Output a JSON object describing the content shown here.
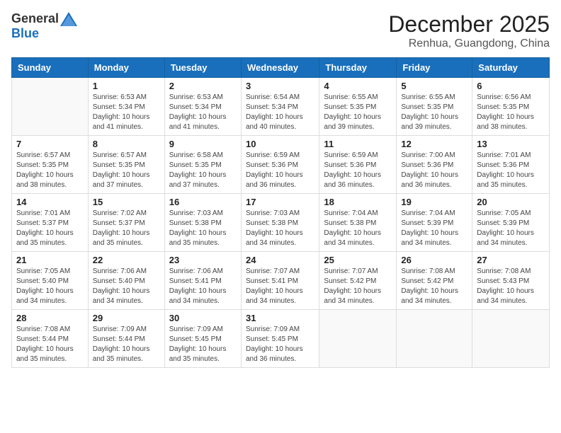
{
  "logo": {
    "general": "General",
    "blue": "Blue"
  },
  "title": "December 2025",
  "location": "Renhua, Guangdong, China",
  "headers": [
    "Sunday",
    "Monday",
    "Tuesday",
    "Wednesday",
    "Thursday",
    "Friday",
    "Saturday"
  ],
  "weeks": [
    [
      {
        "day": "",
        "info": ""
      },
      {
        "day": "1",
        "info": "Sunrise: 6:53 AM\nSunset: 5:34 PM\nDaylight: 10 hours\nand 41 minutes."
      },
      {
        "day": "2",
        "info": "Sunrise: 6:53 AM\nSunset: 5:34 PM\nDaylight: 10 hours\nand 41 minutes."
      },
      {
        "day": "3",
        "info": "Sunrise: 6:54 AM\nSunset: 5:34 PM\nDaylight: 10 hours\nand 40 minutes."
      },
      {
        "day": "4",
        "info": "Sunrise: 6:55 AM\nSunset: 5:35 PM\nDaylight: 10 hours\nand 39 minutes."
      },
      {
        "day": "5",
        "info": "Sunrise: 6:55 AM\nSunset: 5:35 PM\nDaylight: 10 hours\nand 39 minutes."
      },
      {
        "day": "6",
        "info": "Sunrise: 6:56 AM\nSunset: 5:35 PM\nDaylight: 10 hours\nand 38 minutes."
      }
    ],
    [
      {
        "day": "7",
        "info": "Sunrise: 6:57 AM\nSunset: 5:35 PM\nDaylight: 10 hours\nand 38 minutes."
      },
      {
        "day": "8",
        "info": "Sunrise: 6:57 AM\nSunset: 5:35 PM\nDaylight: 10 hours\nand 37 minutes."
      },
      {
        "day": "9",
        "info": "Sunrise: 6:58 AM\nSunset: 5:35 PM\nDaylight: 10 hours\nand 37 minutes."
      },
      {
        "day": "10",
        "info": "Sunrise: 6:59 AM\nSunset: 5:36 PM\nDaylight: 10 hours\nand 36 minutes."
      },
      {
        "day": "11",
        "info": "Sunrise: 6:59 AM\nSunset: 5:36 PM\nDaylight: 10 hours\nand 36 minutes."
      },
      {
        "day": "12",
        "info": "Sunrise: 7:00 AM\nSunset: 5:36 PM\nDaylight: 10 hours\nand 36 minutes."
      },
      {
        "day": "13",
        "info": "Sunrise: 7:01 AM\nSunset: 5:36 PM\nDaylight: 10 hours\nand 35 minutes."
      }
    ],
    [
      {
        "day": "14",
        "info": "Sunrise: 7:01 AM\nSunset: 5:37 PM\nDaylight: 10 hours\nand 35 minutes."
      },
      {
        "day": "15",
        "info": "Sunrise: 7:02 AM\nSunset: 5:37 PM\nDaylight: 10 hours\nand 35 minutes."
      },
      {
        "day": "16",
        "info": "Sunrise: 7:03 AM\nSunset: 5:38 PM\nDaylight: 10 hours\nand 35 minutes."
      },
      {
        "day": "17",
        "info": "Sunrise: 7:03 AM\nSunset: 5:38 PM\nDaylight: 10 hours\nand 34 minutes."
      },
      {
        "day": "18",
        "info": "Sunrise: 7:04 AM\nSunset: 5:38 PM\nDaylight: 10 hours\nand 34 minutes."
      },
      {
        "day": "19",
        "info": "Sunrise: 7:04 AM\nSunset: 5:39 PM\nDaylight: 10 hours\nand 34 minutes."
      },
      {
        "day": "20",
        "info": "Sunrise: 7:05 AM\nSunset: 5:39 PM\nDaylight: 10 hours\nand 34 minutes."
      }
    ],
    [
      {
        "day": "21",
        "info": "Sunrise: 7:05 AM\nSunset: 5:40 PM\nDaylight: 10 hours\nand 34 minutes."
      },
      {
        "day": "22",
        "info": "Sunrise: 7:06 AM\nSunset: 5:40 PM\nDaylight: 10 hours\nand 34 minutes."
      },
      {
        "day": "23",
        "info": "Sunrise: 7:06 AM\nSunset: 5:41 PM\nDaylight: 10 hours\nand 34 minutes."
      },
      {
        "day": "24",
        "info": "Sunrise: 7:07 AM\nSunset: 5:41 PM\nDaylight: 10 hours\nand 34 minutes."
      },
      {
        "day": "25",
        "info": "Sunrise: 7:07 AM\nSunset: 5:42 PM\nDaylight: 10 hours\nand 34 minutes."
      },
      {
        "day": "26",
        "info": "Sunrise: 7:08 AM\nSunset: 5:42 PM\nDaylight: 10 hours\nand 34 minutes."
      },
      {
        "day": "27",
        "info": "Sunrise: 7:08 AM\nSunset: 5:43 PM\nDaylight: 10 hours\nand 34 minutes."
      }
    ],
    [
      {
        "day": "28",
        "info": "Sunrise: 7:08 AM\nSunset: 5:44 PM\nDaylight: 10 hours\nand 35 minutes."
      },
      {
        "day": "29",
        "info": "Sunrise: 7:09 AM\nSunset: 5:44 PM\nDaylight: 10 hours\nand 35 minutes."
      },
      {
        "day": "30",
        "info": "Sunrise: 7:09 AM\nSunset: 5:45 PM\nDaylight: 10 hours\nand 35 minutes."
      },
      {
        "day": "31",
        "info": "Sunrise: 7:09 AM\nSunset: 5:45 PM\nDaylight: 10 hours\nand 36 minutes."
      },
      {
        "day": "",
        "info": ""
      },
      {
        "day": "",
        "info": ""
      },
      {
        "day": "",
        "info": ""
      }
    ]
  ]
}
